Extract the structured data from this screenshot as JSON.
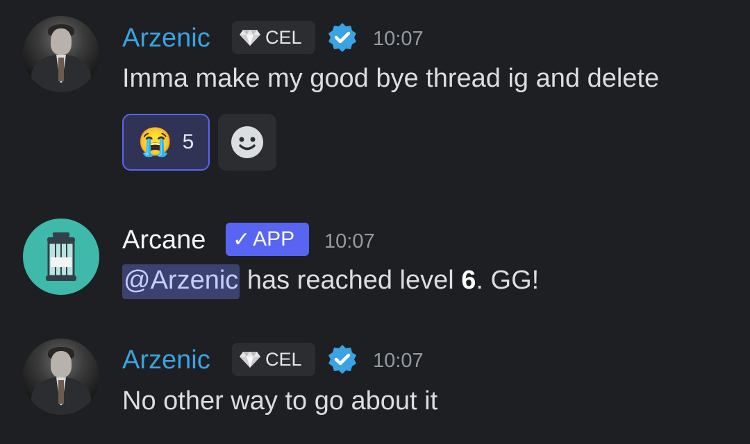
{
  "messages": [
    {
      "author": "Arzenic",
      "badge": "CEL",
      "badge_icon": "diamond-icon",
      "verified_icon": "verified-check-icon",
      "time": "10:07",
      "text": "Imma make my good bye thread ig and delete",
      "reactions": [
        {
          "emoji": "😭",
          "emoji_name": "loudly-crying-emoji",
          "count": "5"
        }
      ],
      "add_reaction_icon": "smiley-add-reaction-icon"
    },
    {
      "author": "Arcane",
      "badge": "APP",
      "badge_check": "✓",
      "time": "10:07",
      "mention": "@Arzenic",
      "text_middle": " has reached level ",
      "level": "6",
      "text_end": ". GG!"
    },
    {
      "author": "Arzenic",
      "badge": "CEL",
      "badge_icon": "diamond-icon",
      "verified_icon": "verified-check-icon",
      "time": "10:07",
      "text": "No other way to go about it"
    }
  ],
  "colors": {
    "background": "#1e1f22",
    "username_blue": "#3aa3e3",
    "app_badge": "#5865f2",
    "verified": "#3aa3e3",
    "bot_avatar": "#3fb9aa"
  }
}
